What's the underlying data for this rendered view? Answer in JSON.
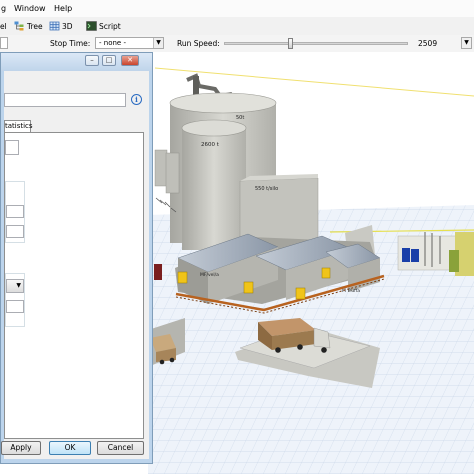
{
  "menu": {
    "partial_item": "g",
    "window": "Window",
    "help": "Help"
  },
  "toolbar": {
    "partial_label": "el",
    "tree_label": "Tree",
    "view3d_label": "3D",
    "script_label": "Script"
  },
  "run_controls": {
    "stop_time_label": "Stop Time:",
    "stop_time_value": "- none -",
    "run_speed_label": "Run Speed:",
    "run_speed_value": "2509",
    "run_speed_fraction": 0.36
  },
  "properties_window": {
    "tab_label": "tatistics",
    "apply_label": "Apply",
    "ok_label": "OK",
    "cancel_label": "Cancel"
  },
  "scene": {
    "labels": {
      "silo_top": "50t",
      "silo_main": "2600 t",
      "silo_right": "550 t/silo",
      "conveyor_left": "MF/vel/a",
      "conveyor_right": "M Truffa"
    }
  },
  "colors": {
    "menu_bg": "#fbfbfb",
    "toolbar_bg": "#f1f1f1",
    "window_frame": "#bcd4ec",
    "floor": "#eef3fa",
    "truck_cargo": "#9c7a4f"
  }
}
